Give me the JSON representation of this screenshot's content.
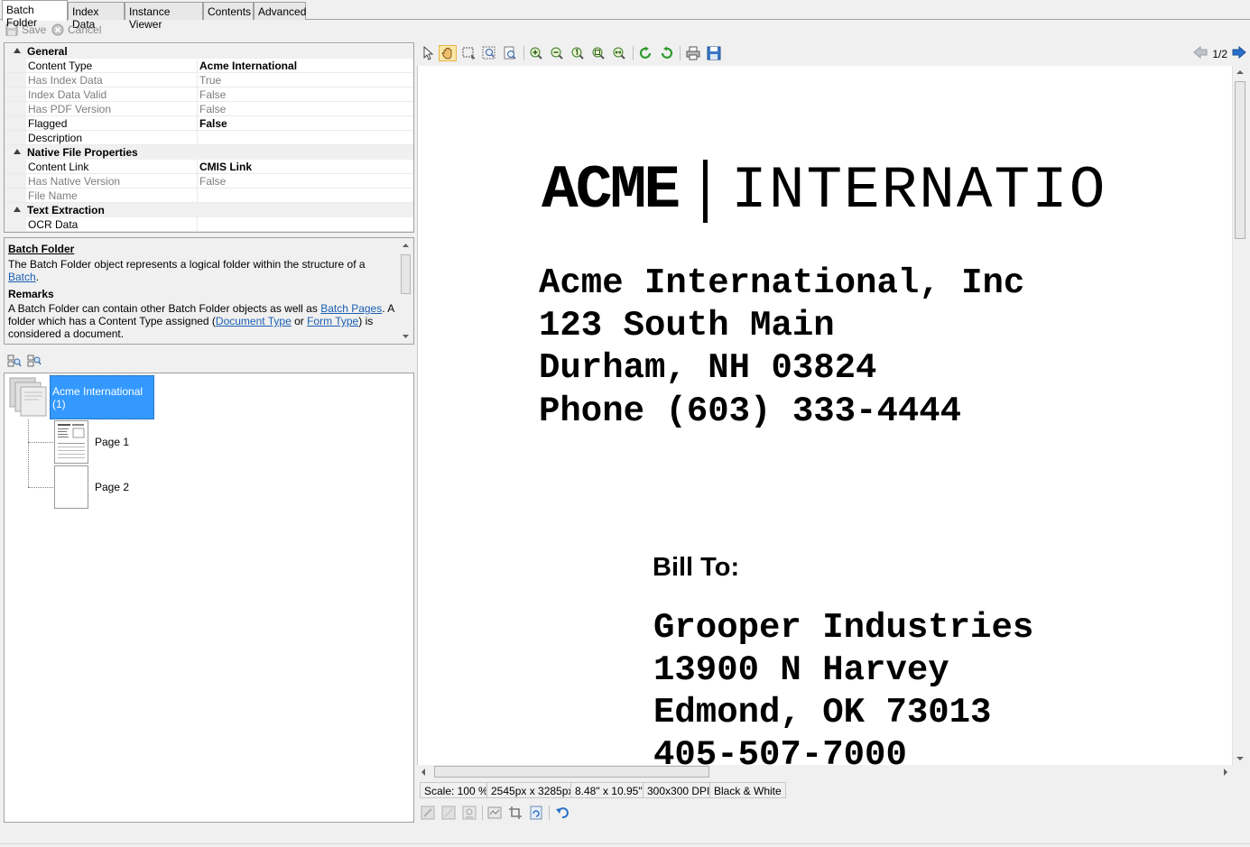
{
  "tabs": [
    {
      "label": "Batch Folder",
      "active": true
    },
    {
      "label": "Index Data",
      "active": false
    },
    {
      "label": "Instance Viewer",
      "active": false
    },
    {
      "label": "Contents",
      "active": false
    },
    {
      "label": "Advanced",
      "active": false
    }
  ],
  "commands": {
    "save": "Save",
    "cancel": "Cancel"
  },
  "properties": {
    "general": {
      "title": "General",
      "rows": [
        {
          "name": "Content Type",
          "value": "Acme International"
        },
        {
          "name": "Has Index Data",
          "value": "True"
        },
        {
          "name": "Index Data Valid",
          "value": "False"
        },
        {
          "name": "Has PDF Version",
          "value": "False"
        },
        {
          "name": "Flagged",
          "value": "False"
        },
        {
          "name": "Description",
          "value": ""
        }
      ]
    },
    "native": {
      "title": "Native File Properties",
      "rows": [
        {
          "name": "Content Link",
          "value": "CMIS Link"
        },
        {
          "name": "Has Native Version",
          "value": "False"
        },
        {
          "name": "File Name",
          "value": ""
        }
      ]
    },
    "text": {
      "title": "Text Extraction",
      "rows": [
        {
          "name": "OCR Data",
          "value": ""
        }
      ]
    }
  },
  "help": {
    "title": "Batch Folder",
    "desc_prefix": "The Batch Folder object represents a logical folder within the structure of a ",
    "desc_link": "Batch",
    "desc_suffix": ".",
    "remarks_title": "Remarks",
    "remarks_1": "A Batch Folder can contain other Batch Folder objects as well as ",
    "remarks_link1": "Batch Pages",
    "remarks_2": ". A folder which has a Content Type assigned (",
    "remarks_link2": "Document Type",
    "remarks_3": " or ",
    "remarks_link3": "Form Type",
    "remarks_4": ") is considered a document."
  },
  "tree": {
    "folder_label": "Acme International (1)",
    "pages": [
      {
        "label": "Page 1"
      },
      {
        "label": "Page 2"
      }
    ]
  },
  "viewer": {
    "page_indicator": "1/2",
    "doc": {
      "logo_bold": "ACME",
      "logo_light": "INTERNATIO",
      "address": [
        "Acme International, Inc",
        "123 South Main",
        "Durham, NH 03824",
        "Phone (603) 333-4444"
      ],
      "bill_to_label": "Bill To:",
      "bill_to": [
        "Grooper Industries",
        "13900 N Harvey",
        "Edmond, OK 73013",
        "405-507-7000"
      ]
    }
  },
  "status": {
    "scale": "Scale: 100 %",
    "pixels": "2545px x 3285px",
    "inches": "8.48\" x 10.95\"",
    "dpi": "300x300 DPI",
    "color": "Black & White"
  },
  "icons": {
    "accent": "#3399ff",
    "link": "#1a5fb4",
    "green_rotate": "#2e9b2e",
    "blue_arrow": "#2a6fc9"
  }
}
